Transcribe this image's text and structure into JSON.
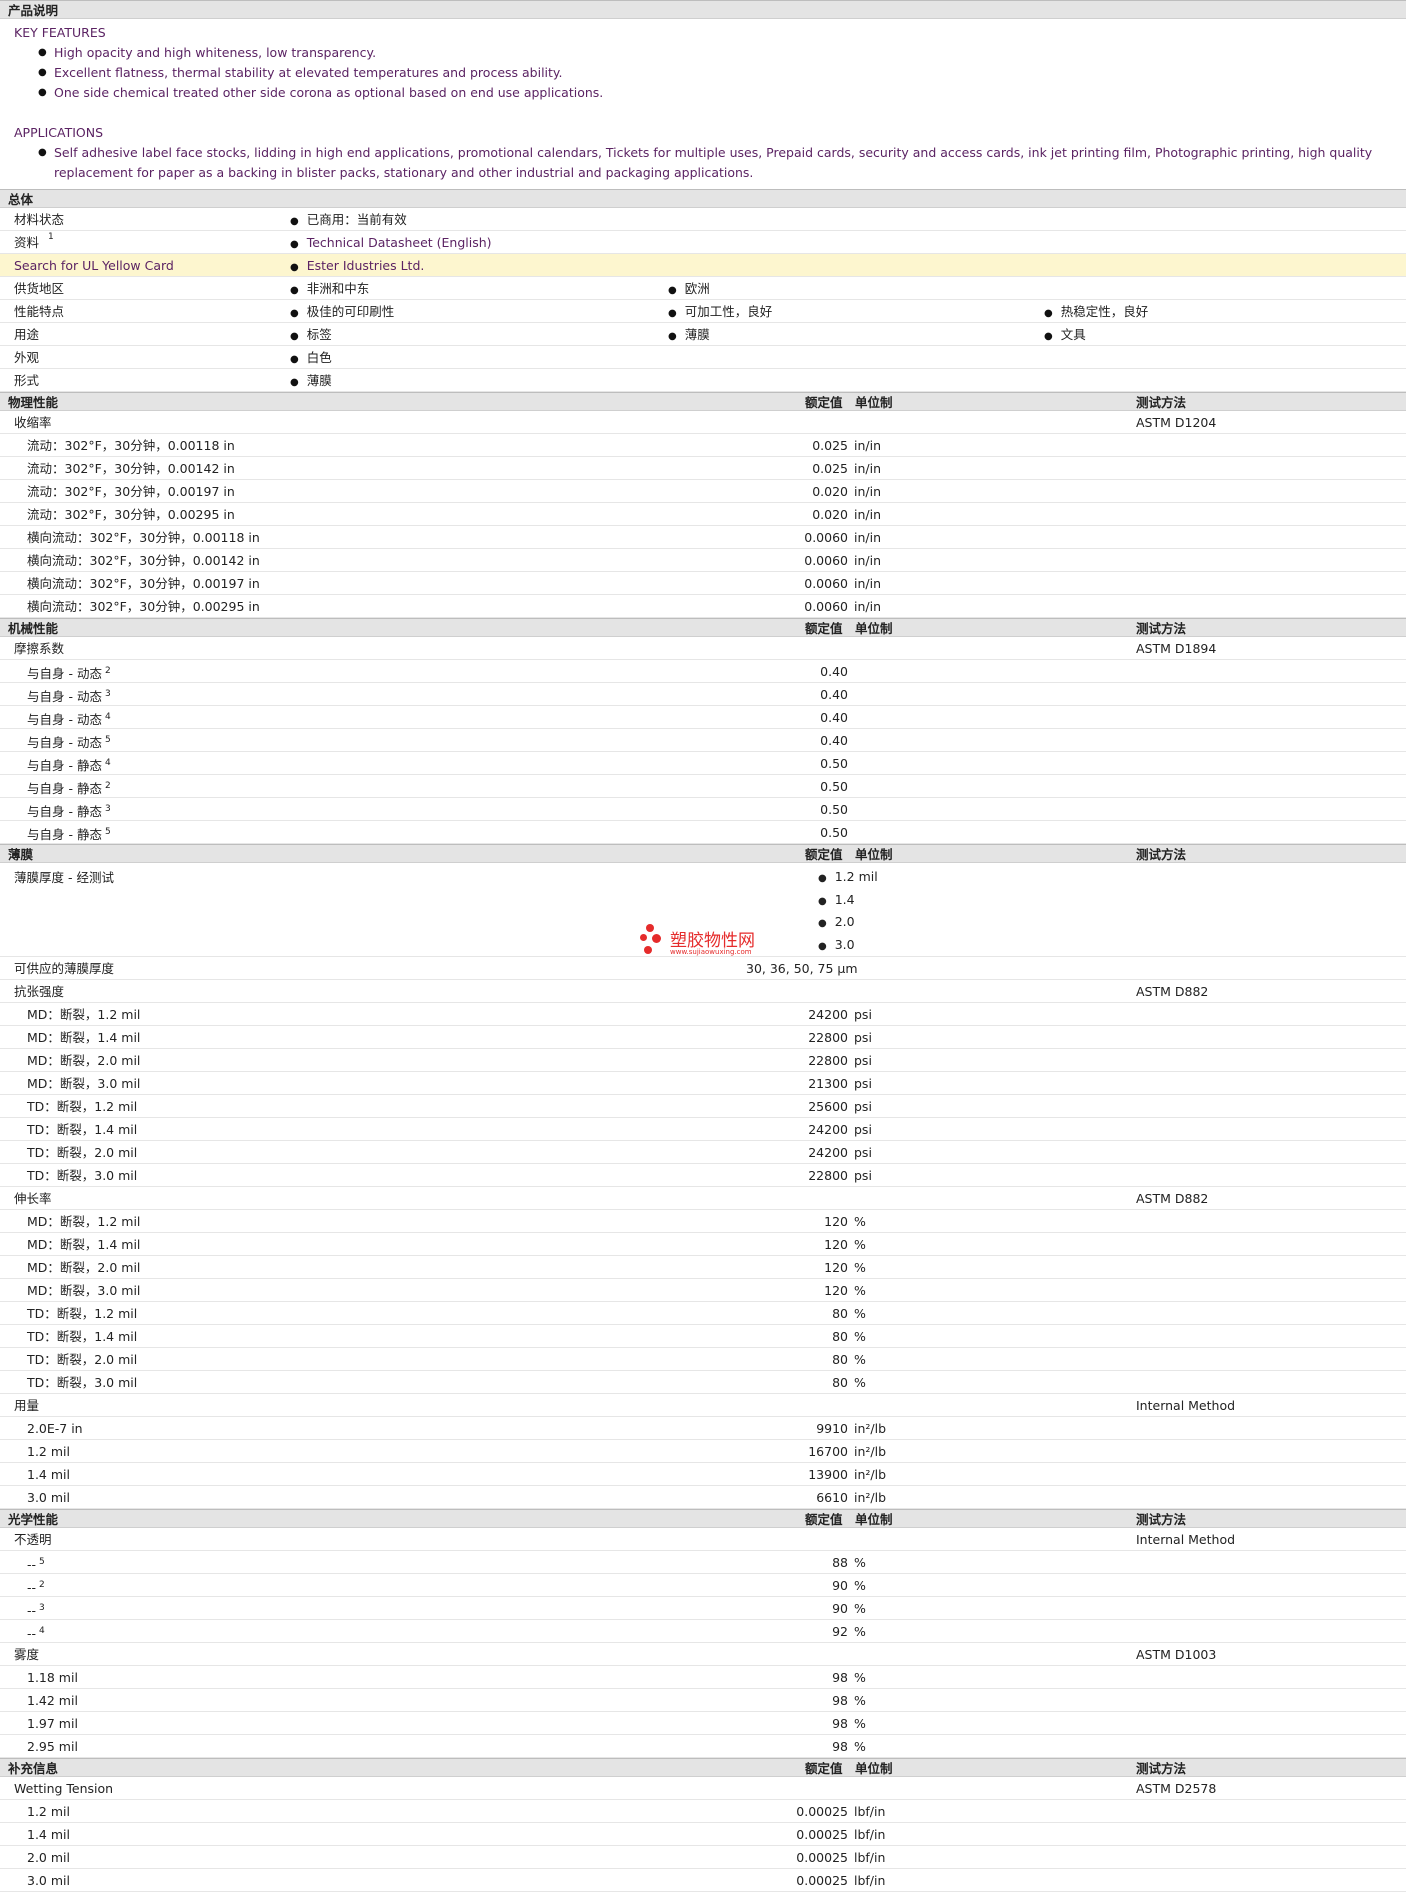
{
  "product": {
    "header": "产品说明",
    "key_features_title": "KEY FEATURES",
    "key_features": [
      "High opacity and high whiteness, low transparency.",
      "Excellent flatness, thermal stability at elevated temperatures and process ability.",
      "One side chemical treated other side corona as optional based on end use applications."
    ],
    "applications_title": "APPLICATIONS",
    "applications": "Self adhesive label face stocks, lidding in high end applications, promotional calendars, Tickets for multiple uses, Prepaid cards, security and access cards, ink jet printing film, Photographic printing, high quality replacement for paper as a backing in blister packs, stationary and other industrial and packaging applications."
  },
  "general": {
    "header": "总体",
    "rows": [
      {
        "label": "材料状态",
        "values": [
          "已商用：当前有效"
        ]
      },
      {
        "label": "资料",
        "sup": "1",
        "values": [
          "Technical Datasheet (English)"
        ],
        "link": true
      },
      {
        "label": "Search for UL Yellow Card",
        "values": [
          "Ester Idustries Ltd."
        ],
        "link": true,
        "highlight": true
      },
      {
        "label": "供货地区",
        "values": [
          "非洲和中东",
          "欧洲"
        ]
      },
      {
        "label": "性能特点",
        "values": [
          "极佳的可印刷性",
          "可加工性，良好",
          "热稳定性，良好"
        ]
      },
      {
        "label": "用途",
        "values": [
          "标签",
          "薄膜",
          "文具"
        ]
      },
      {
        "label": "外观",
        "values": [
          "白色"
        ]
      },
      {
        "label": "形式",
        "values": [
          "薄膜"
        ]
      }
    ]
  },
  "col_headers": {
    "value": "额定值",
    "unit": "单位制",
    "method": "测试方法"
  },
  "physical": {
    "header": "物理性能",
    "groups": [
      {
        "label": "收缩率",
        "method": "ASTM D1204",
        "rows": [
          {
            "label": "流动：302°F，30分钟，0.00118 in",
            "value": "0.025",
            "unit": "in/in"
          },
          {
            "label": "流动：302°F，30分钟，0.00142 in",
            "value": "0.025",
            "unit": "in/in"
          },
          {
            "label": "流动：302°F，30分钟，0.00197 in",
            "value": "0.020",
            "unit": "in/in"
          },
          {
            "label": "流动：302°F，30分钟，0.00295 in",
            "value": "0.020",
            "unit": "in/in"
          },
          {
            "label": "横向流动：302°F，30分钟，0.00118 in",
            "value": "0.0060",
            "unit": "in/in"
          },
          {
            "label": "横向流动：302°F，30分钟，0.00142 in",
            "value": "0.0060",
            "unit": "in/in"
          },
          {
            "label": "横向流动：302°F，30分钟，0.00197 in",
            "value": "0.0060",
            "unit": "in/in"
          },
          {
            "label": "横向流动：302°F，30分钟，0.00295 in",
            "value": "0.0060",
            "unit": "in/in"
          }
        ]
      }
    ]
  },
  "mechanical": {
    "header": "机械性能",
    "groups": [
      {
        "label": "摩擦系数",
        "method": "ASTM D1894",
        "rows": [
          {
            "label": "与自身 - 动态",
            "sup": "2",
            "value": "0.40",
            "unit": ""
          },
          {
            "label": "与自身 - 动态",
            "sup": "3",
            "value": "0.40",
            "unit": ""
          },
          {
            "label": "与自身 - 动态",
            "sup": "4",
            "value": "0.40",
            "unit": ""
          },
          {
            "label": "与自身 - 动态",
            "sup": "5",
            "value": "0.40",
            "unit": ""
          },
          {
            "label": "与自身 - 静态",
            "sup": "4",
            "value": "0.50",
            "unit": ""
          },
          {
            "label": "与自身 - 静态",
            "sup": "2",
            "value": "0.50",
            "unit": ""
          },
          {
            "label": "与自身 - 静态",
            "sup": "3",
            "value": "0.50",
            "unit": ""
          },
          {
            "label": "与自身 - 静态",
            "sup": "5",
            "value": "0.50",
            "unit": ""
          }
        ]
      }
    ]
  },
  "film": {
    "header": "薄膜",
    "thickness_label": "薄膜厚度 - 经测试",
    "thickness_values": [
      "1.2 mil",
      "1.4",
      "2.0",
      "3.0"
    ],
    "available_label": "可供应的薄膜厚度",
    "available_value": "30, 36, 50, 75 µm",
    "groups": [
      {
        "label": "抗张强度",
        "method": "ASTM D882",
        "rows": [
          {
            "label": "MD：断裂，1.2 mil",
            "value": "24200",
            "unit": "psi"
          },
          {
            "label": "MD：断裂，1.4 mil",
            "value": "22800",
            "unit": "psi"
          },
          {
            "label": "MD：断裂，2.0 mil",
            "value": "22800",
            "unit": "psi"
          },
          {
            "label": "MD：断裂，3.0 mil",
            "value": "21300",
            "unit": "psi"
          },
          {
            "label": "TD：断裂，1.2 mil",
            "value": "25600",
            "unit": "psi"
          },
          {
            "label": "TD：断裂，1.4 mil",
            "value": "24200",
            "unit": "psi"
          },
          {
            "label": "TD：断裂，2.0 mil",
            "value": "24200",
            "unit": "psi"
          },
          {
            "label": "TD：断裂，3.0 mil",
            "value": "22800",
            "unit": "psi"
          }
        ]
      },
      {
        "label": "伸长率",
        "method": "ASTM D882",
        "rows": [
          {
            "label": "MD：断裂，1.2 mil",
            "value": "120",
            "unit": "%"
          },
          {
            "label": "MD：断裂，1.4 mil",
            "value": "120",
            "unit": "%"
          },
          {
            "label": "MD：断裂，2.0 mil",
            "value": "120",
            "unit": "%"
          },
          {
            "label": "MD：断裂，3.0 mil",
            "value": "120",
            "unit": "%"
          },
          {
            "label": "TD：断裂，1.2 mil",
            "value": "80",
            "unit": "%"
          },
          {
            "label": "TD：断裂，1.4 mil",
            "value": "80",
            "unit": "%"
          },
          {
            "label": "TD：断裂，2.0 mil",
            "value": "80",
            "unit": "%"
          },
          {
            "label": "TD：断裂，3.0 mil",
            "value": "80",
            "unit": "%"
          }
        ]
      },
      {
        "label": "用量",
        "method": "Internal Method",
        "rows": [
          {
            "label": "2.0E-7 in",
            "value": "9910",
            "unit": "in²/lb"
          },
          {
            "label": "1.2 mil",
            "value": "16700",
            "unit": "in²/lb"
          },
          {
            "label": "1.4 mil",
            "value": "13900",
            "unit": "in²/lb"
          },
          {
            "label": "3.0 mil",
            "value": "6610",
            "unit": "in²/lb"
          }
        ]
      }
    ]
  },
  "optical": {
    "header": "光学性能",
    "groups": [
      {
        "label": "不透明",
        "method": "Internal Method",
        "rows": [
          {
            "label": "--",
            "sup": "5",
            "value": "88",
            "unit": "%"
          },
          {
            "label": "--",
            "sup": "2",
            "value": "90",
            "unit": "%"
          },
          {
            "label": "--",
            "sup": "3",
            "value": "90",
            "unit": "%"
          },
          {
            "label": "--",
            "sup": "4",
            "value": "92",
            "unit": "%"
          }
        ]
      },
      {
        "label": "雾度",
        "method": "ASTM D1003",
        "rows": [
          {
            "label": "1.18 mil",
            "value": "98",
            "unit": "%"
          },
          {
            "label": "1.42 mil",
            "value": "98",
            "unit": "%"
          },
          {
            "label": "1.97 mil",
            "value": "98",
            "unit": "%"
          },
          {
            "label": "2.95 mil",
            "value": "98",
            "unit": "%"
          }
        ]
      }
    ]
  },
  "supplementary": {
    "header": "补充信息",
    "groups": [
      {
        "label": "Wetting Tension",
        "method": "ASTM D2578",
        "rows": [
          {
            "label": "1.2 mil",
            "value": "0.00025",
            "unit": "lbf/in"
          },
          {
            "label": "1.4 mil",
            "value": "0.00025",
            "unit": "lbf/in"
          },
          {
            "label": "2.0 mil",
            "value": "0.00025",
            "unit": "lbf/in"
          },
          {
            "label": "3.0 mil",
            "value": "0.00025",
            "unit": "lbf/in"
          }
        ]
      }
    ]
  },
  "watermark": {
    "text": "塑胶物性网",
    "url": "www.sujiaowuxing.com"
  },
  "colors": {
    "link": "#5b2363",
    "header_bg": "#e4e4e4",
    "highlight": "#fdf6cf"
  }
}
